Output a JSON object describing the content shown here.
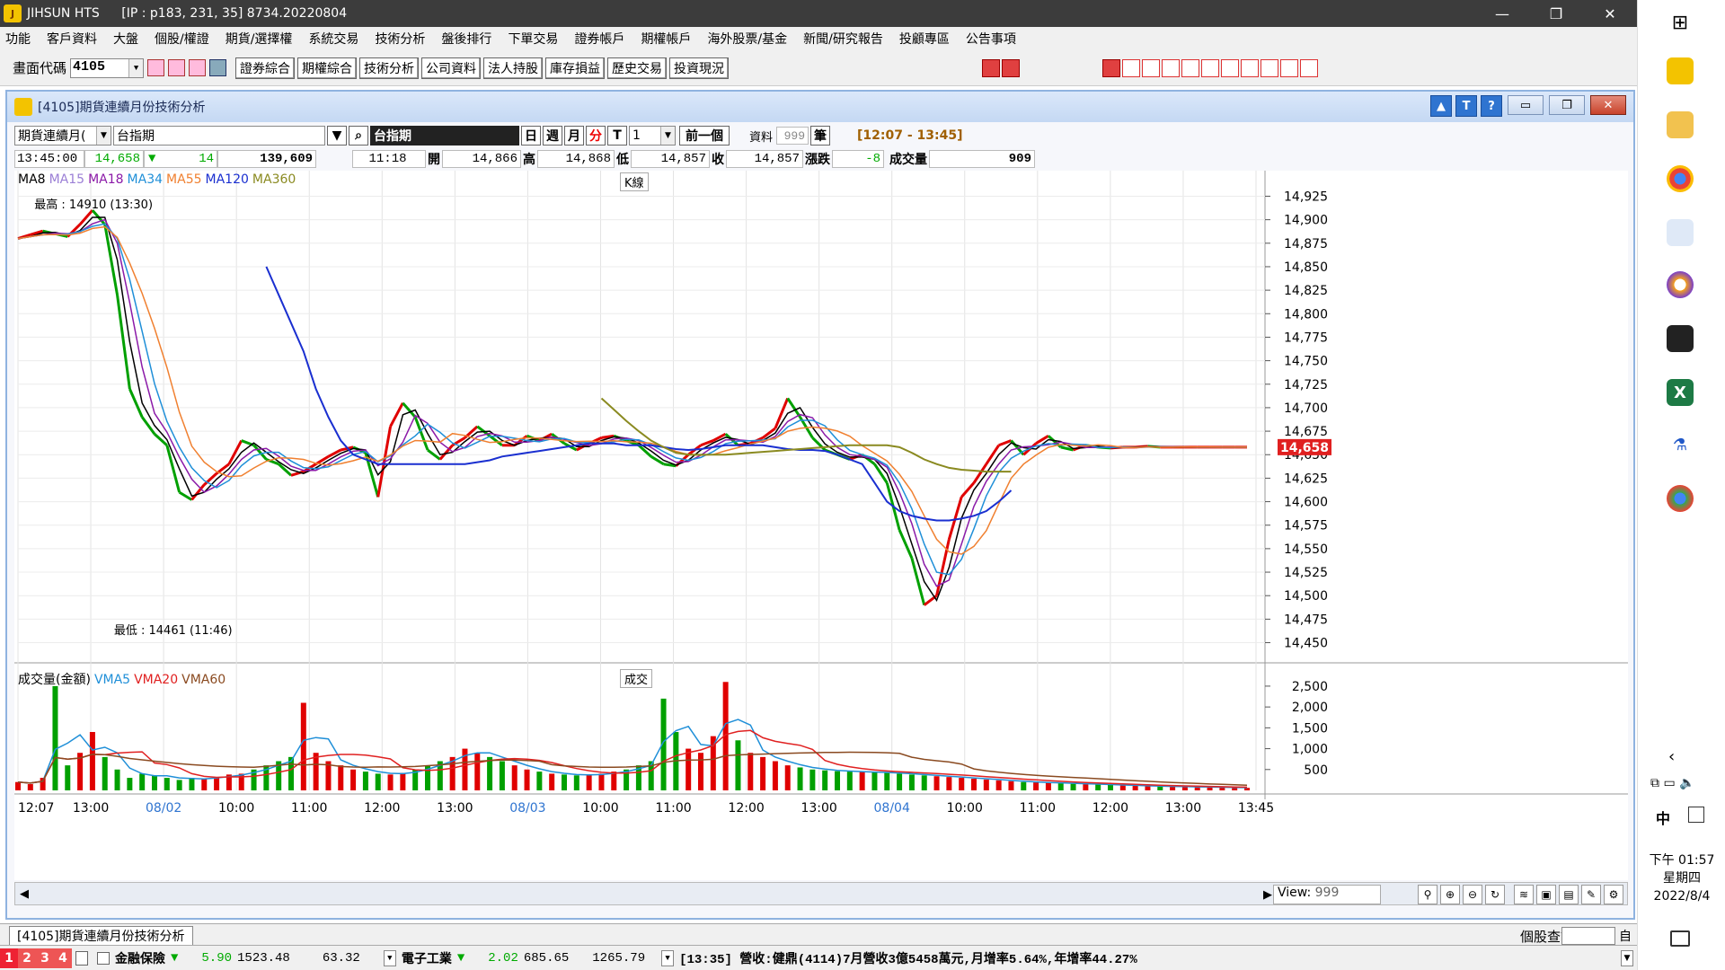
{
  "window": {
    "app_name": "JIHSUN HTS",
    "ip_info": "[IP : p183, 231, 35] 8734.20220804"
  },
  "menu": [
    "功能",
    "客戶資料",
    "大盤",
    "個股/權證",
    "期貨/選擇權",
    "系統交易",
    "技術分析",
    "盤後排行",
    "下單交易",
    "證券帳戶",
    "期權帳戶",
    "海外股票/基金",
    "新聞/研究報告",
    "投顧專區",
    "公告事項"
  ],
  "toolbar": {
    "code_label": "畫面代碼",
    "code_value": "4105",
    "buttons": [
      "證券綜合",
      "期權綜合",
      "技術分析",
      "公司資料",
      "法人持股",
      "庫存損益",
      "歷史交易",
      "投資現況"
    ]
  },
  "mdi": {
    "title": "[4105]期貨連續月份技術分析",
    "product_select": "期貨連續月(",
    "symbol_input": "台指期",
    "symbol_name": "台指期",
    "period_buttons": [
      "日",
      "週",
      "月",
      "分",
      "T"
    ],
    "active_period": "分",
    "interval_value": "1",
    "prev_button": "前一個",
    "data_label": "資料",
    "data_count": "999",
    "data_unit": "筆",
    "range": "[12:07 - 13:45]"
  },
  "quote": {
    "time": "13:45:00",
    "price": "14,658",
    "change": "14",
    "volume_total": "139,609",
    "bar_time": "11:18",
    "open_label": "開",
    "open": "14,866",
    "high_label": "高",
    "high": "14,868",
    "low_label": "低",
    "low": "14,857",
    "close_label": "收",
    "close": "14,857",
    "chg_label": "漲跌",
    "chg": "-8",
    "vol_label": "成交量",
    "vol": "909"
  },
  "ma_legend": [
    {
      "label": "MA8",
      "color": "#000000"
    },
    {
      "label": "MA15",
      "color": "#9b7fd6"
    },
    {
      "label": "MA18",
      "color": "#8b1aa8"
    },
    {
      "label": "MA34",
      "color": "#1f8fd8"
    },
    {
      "label": "MA55",
      "color": "#f08030"
    },
    {
      "label": "MA120",
      "color": "#1a2fd0"
    },
    {
      "label": "MA360",
      "color": "#8a8a20"
    }
  ],
  "kline_label": "K線",
  "trade_label": "成交",
  "vol_legend": [
    {
      "label": "成交量(金額)",
      "color": "#000000"
    },
    {
      "label": "VMA5",
      "color": "#1f8fd8"
    },
    {
      "label": "VMA20",
      "color": "#e02020"
    },
    {
      "label": "VMA60",
      "color": "#8a4a20"
    }
  ],
  "chart_data": {
    "type": "line",
    "price_axis_ticks": [
      "14,925",
      "14,900",
      "14,875",
      "14,850",
      "14,825",
      "14,800",
      "14,775",
      "14,750",
      "14,725",
      "14,700",
      "14,675",
      "14,650",
      "14,625",
      "14,600",
      "14,575",
      "14,550",
      "14,525",
      "14,500",
      "14,475",
      "14,450"
    ],
    "ylim": [
      14440,
      14935
    ],
    "last_price": "14,658",
    "high_annotation": "最高 : 14910 (13:30)",
    "low_annotation": "最低 : 14461 (11:46)",
    "volume_axis_ticks": [
      "2,500",
      "2,000",
      "1,500",
      "1,000",
      "500"
    ],
    "x_tick_labels": [
      "12:07",
      "13:00",
      "08/02",
      "10:00",
      "11:00",
      "12:00",
      "13:00",
      "08/03",
      "10:00",
      "11:00",
      "12:00",
      "13:00",
      "08/04",
      "10:00",
      "11:00",
      "12:00",
      "13:00",
      "13:45"
    ],
    "date_ticks": [
      "08/02",
      "08/03",
      "08/04"
    ],
    "x": [
      0,
      10,
      20,
      30,
      40,
      50,
      60,
      70,
      80,
      90,
      100,
      110,
      120,
      130,
      140,
      150,
      160,
      170,
      180,
      190,
      200,
      210,
      220,
      230,
      240,
      250,
      260,
      270,
      280,
      290,
      300,
      310,
      320,
      330,
      340,
      350,
      360,
      370,
      380,
      390,
      400,
      410,
      420,
      430,
      440,
      450,
      460,
      470,
      480,
      490,
      500,
      510,
      520,
      530,
      540,
      550,
      560,
      570,
      580,
      590,
      600,
      610,
      620,
      630,
      640,
      650,
      660,
      670,
      680,
      690,
      700,
      710,
      720,
      730,
      740,
      750,
      760,
      770,
      780,
      790,
      800,
      810,
      820,
      830,
      840,
      850,
      860,
      870,
      880,
      890,
      900,
      910,
      920,
      930,
      940,
      950,
      960,
      970,
      980,
      990
    ],
    "close": [
      14880,
      14884,
      14888,
      14885,
      14882,
      14895,
      14910,
      14895,
      14820,
      14720,
      14690,
      14672,
      14660,
      14610,
      14602,
      14618,
      14630,
      14640,
      14665,
      14660,
      14645,
      14640,
      14628,
      14632,
      14640,
      14648,
      14655,
      14658,
      14652,
      14605,
      14680,
      14705,
      14690,
      14655,
      14645,
      14660,
      14668,
      14680,
      14670,
      14660,
      14660,
      14670,
      14665,
      14672,
      14662,
      14655,
      14662,
      14668,
      14670,
      14665,
      14660,
      14648,
      14640,
      14638,
      14650,
      14660,
      14665,
      14672,
      14660,
      14662,
      14668,
      14678,
      14710,
      14690,
      14668,
      14655,
      14650,
      14645,
      14650,
      14640,
      14620,
      14570,
      14540,
      14490,
      14500,
      14560,
      14605,
      14620,
      14640,
      14660,
      14665,
      14650,
      14662,
      14670,
      14658,
      14655,
      14660,
      14658,
      14657,
      14658,
      14658,
      14659,
      14658,
      14658,
      14658,
      14658,
      14658,
      14658,
      14658,
      14658
    ],
    "ma120": [
      null,
      null,
      null,
      null,
      null,
      null,
      null,
      null,
      null,
      null,
      null,
      null,
      null,
      null,
      null,
      null,
      null,
      null,
      null,
      null,
      14850,
      14820,
      14790,
      14760,
      14720,
      14690,
      14665,
      14650,
      14645,
      14640,
      14640,
      14640,
      14640,
      14640,
      14640,
      14640,
      14640,
      14642,
      14644,
      14648,
      14650,
      14652,
      14654,
      14656,
      14658,
      14660,
      14662,
      14662,
      14662,
      14660,
      14660,
      14660,
      14658,
      14656,
      14655,
      14656,
      14658,
      14660,
      14660,
      14660,
      14660,
      14658,
      14656,
      14655,
      14655,
      14654,
      14650,
      14645,
      14640,
      14620,
      14600,
      14590,
      14585,
      14582,
      14580,
      14580,
      14582,
      14585,
      14590,
      14600,
      14612,
      null,
      null,
      null,
      null,
      null,
      null,
      null,
      null,
      null,
      null,
      null,
      null,
      null,
      null,
      null,
      null,
      null,
      null,
      null
    ],
    "ma360": [
      null,
      null,
      null,
      null,
      null,
      null,
      null,
      null,
      null,
      null,
      null,
      null,
      null,
      null,
      null,
      null,
      null,
      null,
      null,
      null,
      null,
      null,
      null,
      null,
      null,
      null,
      null,
      null,
      null,
      null,
      null,
      null,
      null,
      null,
      null,
      null,
      null,
      null,
      null,
      null,
      null,
      null,
      null,
      null,
      null,
      null,
      null,
      14710,
      14698,
      14686,
      14675,
      14665,
      14658,
      14652,
      14650,
      14650,
      14650,
      14650,
      14651,
      14652,
      14653,
      14654,
      14655,
      14656,
      14657,
      14658,
      14659,
      14660,
      14660,
      14660,
      14660,
      14658,
      14652,
      14645,
      14640,
      14636,
      14634,
      14633,
      14632,
      14632,
      14632,
      null,
      null,
      null,
      null,
      null,
      null,
      null,
      null,
      null,
      null,
      null,
      null,
      null,
      null,
      null,
      null,
      null,
      null,
      null
    ],
    "volume": [
      200,
      150,
      300,
      2500,
      600,
      900,
      1400,
      800,
      500,
      300,
      400,
      350,
      300,
      250,
      300,
      280,
      320,
      380,
      400,
      500,
      600,
      700,
      800,
      2100,
      900,
      700,
      600,
      500,
      450,
      400,
      380,
      420,
      500,
      600,
      700,
      800,
      1000,
      900,
      800,
      700,
      600,
      500,
      450,
      400,
      380,
      360,
      380,
      400,
      450,
      500,
      600,
      700,
      2200,
      1400,
      1000,
      900,
      1300,
      2600,
      1200,
      900,
      800,
      700,
      600,
      550,
      500,
      480,
      460,
      450,
      440,
      430,
      420,
      400,
      380,
      360,
      340,
      320,
      300,
      280,
      260,
      240,
      220,
      200,
      190,
      180,
      170,
      160,
      150,
      140,
      130,
      120,
      110,
      100,
      95,
      90,
      85,
      80,
      75,
      70,
      65,
      60
    ]
  },
  "view": {
    "label": "View:",
    "value": "999"
  },
  "bottom": {
    "tab": "[4105]期貨連續月份技術分析",
    "stock_query": "個股查詢",
    "query_suffix": "自",
    "tabs": [
      "1",
      "2",
      "3",
      "4"
    ],
    "sector1": {
      "name": "金融保險",
      "arrow": "▼",
      "chg": "5.90",
      "val1": "1523.48",
      "val2": "63.32"
    },
    "sector2": {
      "name": "電子工業",
      "arrow": "▼",
      "chg": "2.02",
      "val1": "685.65",
      "val2": "1265.79"
    },
    "news": "[13:35] 營收:健鼎(4114)7月營收3億5458萬元,月增率5.64%,年增率44.27%"
  },
  "clock": {
    "time": "下午 01:57",
    "weekday": "星期四",
    "date": "2022/8/4"
  },
  "colors": {
    "up": "#e00000",
    "down": "#00a000",
    "accent": "#2f74d0"
  }
}
